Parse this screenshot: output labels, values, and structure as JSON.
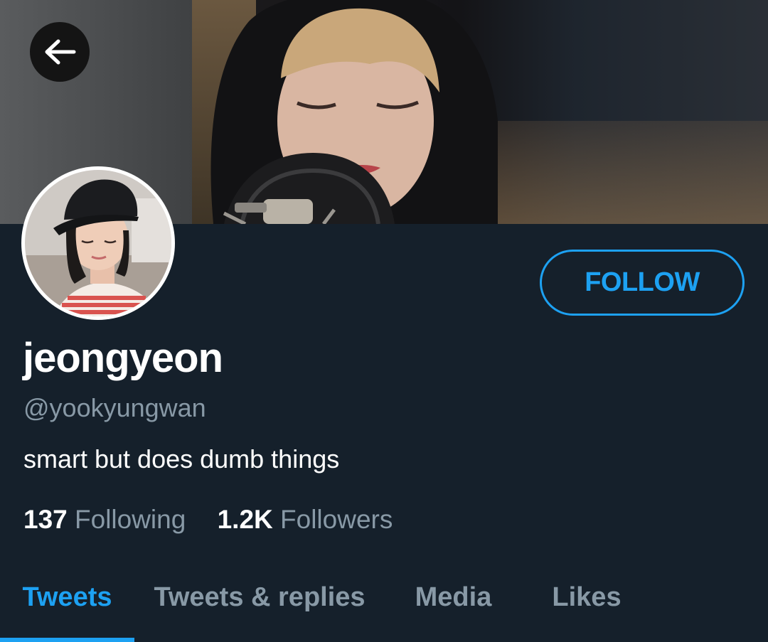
{
  "profile": {
    "display_name": "jeongyeon",
    "handle": "@yookyungwan",
    "bio": "smart but does dumb things"
  },
  "actions": {
    "follow_label": "FOLLOW",
    "back_icon": "arrow-left-icon"
  },
  "stats": {
    "following_count": "137",
    "following_label": "Following",
    "followers_count": "1.2K",
    "followers_label": "Followers"
  },
  "tabs": [
    {
      "label": "Tweets",
      "active": true
    },
    {
      "label": "Tweets & replies",
      "active": false
    },
    {
      "label": "Media",
      "active": false
    },
    {
      "label": "Likes",
      "active": false
    }
  ],
  "colors": {
    "background": "#15202b",
    "accent": "#1da1f2",
    "secondary_text": "#8899a6",
    "primary_text": "#ffffff"
  }
}
